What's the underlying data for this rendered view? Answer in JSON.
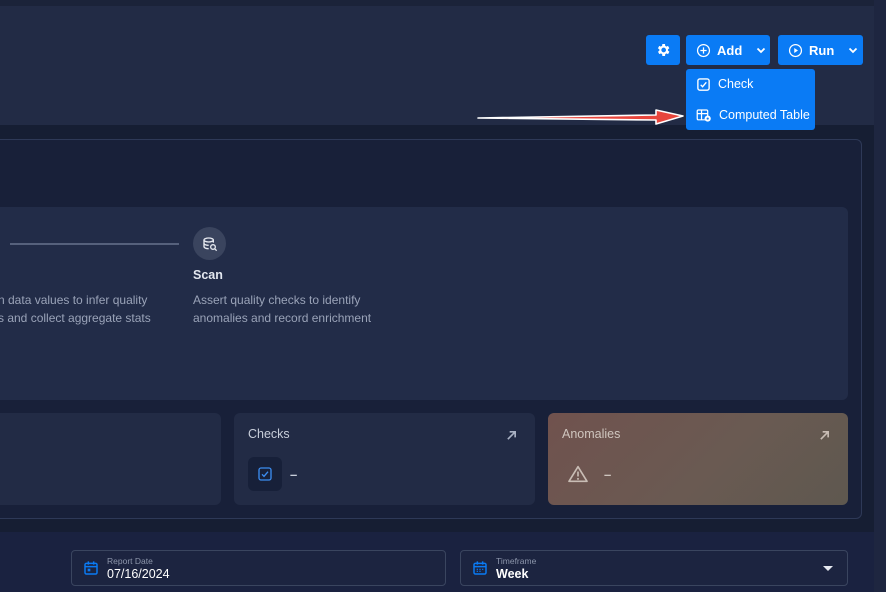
{
  "toolbar": {
    "settings_icon": "gear-icon",
    "add_label": "Add",
    "run_label": "Run"
  },
  "add_menu": {
    "items": [
      {
        "label": "Check",
        "icon": "check-square-icon"
      },
      {
        "label": "Computed Table",
        "icon": "computed-table-icon"
      }
    ]
  },
  "steps": {
    "profile_desc_partial_1": "n data values to infer quality",
    "profile_desc_partial_2": "s and collect aggregate stats",
    "scan": {
      "title": "Scan",
      "desc_1": "Assert quality checks to identify",
      "desc_2": "anomalies and record enrichment"
    }
  },
  "cards": {
    "checks": {
      "title": "Checks",
      "value": "–"
    },
    "anomalies": {
      "title": "Anomalies",
      "value": "–"
    }
  },
  "filters": {
    "report_date": {
      "label": "Report Date",
      "value": "07/16/2024"
    },
    "timeframe": {
      "label": "Timeframe",
      "value": "Week"
    }
  },
  "colors": {
    "accent": "#0a7bf5",
    "background": "#161e33",
    "annotation_arrow": "#e8453c"
  }
}
